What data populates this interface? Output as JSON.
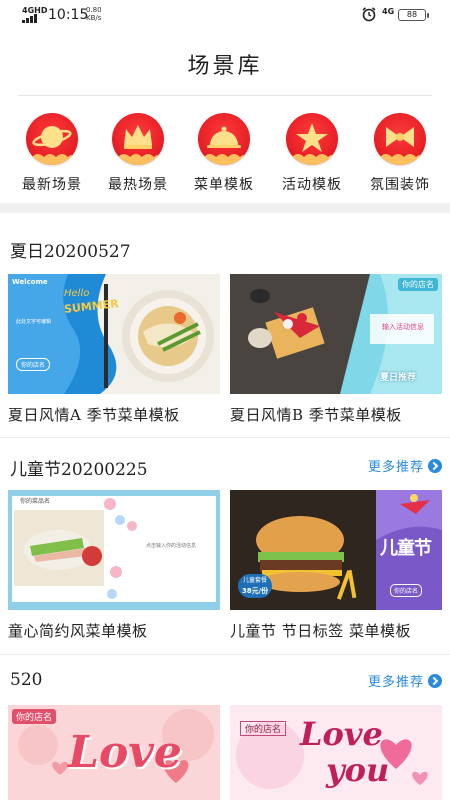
{
  "status_bar": {
    "network": "4GHD",
    "time": "10:15",
    "speed_value": "0.80",
    "speed_unit": "KB/s",
    "network_right": "4G",
    "battery": "88"
  },
  "header": {
    "title": "场景库"
  },
  "categories": [
    {
      "label": "最新场景",
      "icon": "planet-icon"
    },
    {
      "label": "最热场景",
      "icon": "crown-icon"
    },
    {
      "label": "菜单模板",
      "icon": "cloche-icon"
    },
    {
      "label": "活动模板",
      "icon": "star-icon"
    },
    {
      "label": "氛围装饰",
      "icon": "bow-icon"
    }
  ],
  "sections": [
    {
      "title": "夏日20200527",
      "more": "",
      "cards": [
        {
          "caption": "夏日风情A 季节菜单模板",
          "thumb_text": [
            "Welcome",
            "Hello",
            "SUMMER",
            "此处文字可编辑",
            "你的店名"
          ]
        },
        {
          "caption": "夏日风情B 季节菜单模板",
          "thumb_text": [
            "你的店名",
            "输入活动信息",
            "夏日推荐"
          ]
        }
      ]
    },
    {
      "title": "儿童节20200225",
      "more": "更多推荐",
      "cards": [
        {
          "caption": "童心简约风菜单模板",
          "thumb_text": [
            "你的菜品名",
            "点击输入你的活动信息"
          ]
        },
        {
          "caption": "儿童节 节日标签 菜单模板",
          "thumb_text": [
            "儿童套餐",
            "38元/份",
            "儿童节",
            "你的店名"
          ]
        }
      ]
    },
    {
      "title": "520",
      "more": "更多推荐",
      "cards": [
        {
          "caption": "",
          "thumb_text": [
            "你的店名",
            "Love"
          ]
        },
        {
          "caption": "",
          "thumb_text": [
            "你的店名",
            "Love",
            "you"
          ]
        }
      ]
    }
  ],
  "colors": {
    "accent": "#2a8be0",
    "brand_red": "#e0141c"
  }
}
